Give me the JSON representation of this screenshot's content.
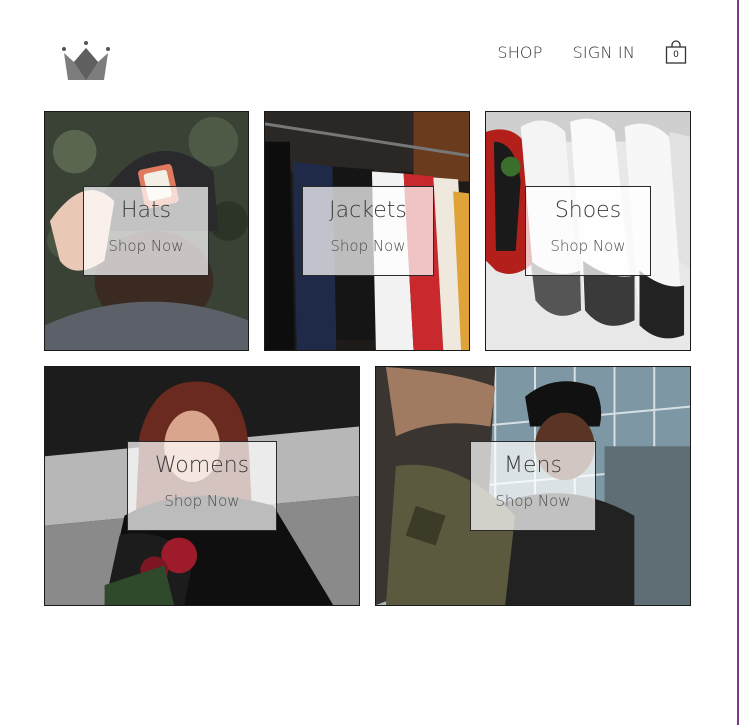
{
  "header": {
    "logo": "crown-logo",
    "nav": [
      {
        "label": "SHOP"
      },
      {
        "label": "SIGN IN"
      }
    ],
    "cart": {
      "icon": "shopping-bag-icon",
      "count": "0"
    }
  },
  "categories": [
    {
      "title": "Hats",
      "cta": "Shop Now"
    },
    {
      "title": "Jackets",
      "cta": "Shop Now"
    },
    {
      "title": "Shoes",
      "cta": "Shop Now"
    },
    {
      "title": "Womens",
      "cta": "Shop Now"
    },
    {
      "title": "Mens",
      "cta": "Shop Now"
    }
  ],
  "colors": {
    "accent_border": "#7a3a86",
    "text": "#333333"
  }
}
